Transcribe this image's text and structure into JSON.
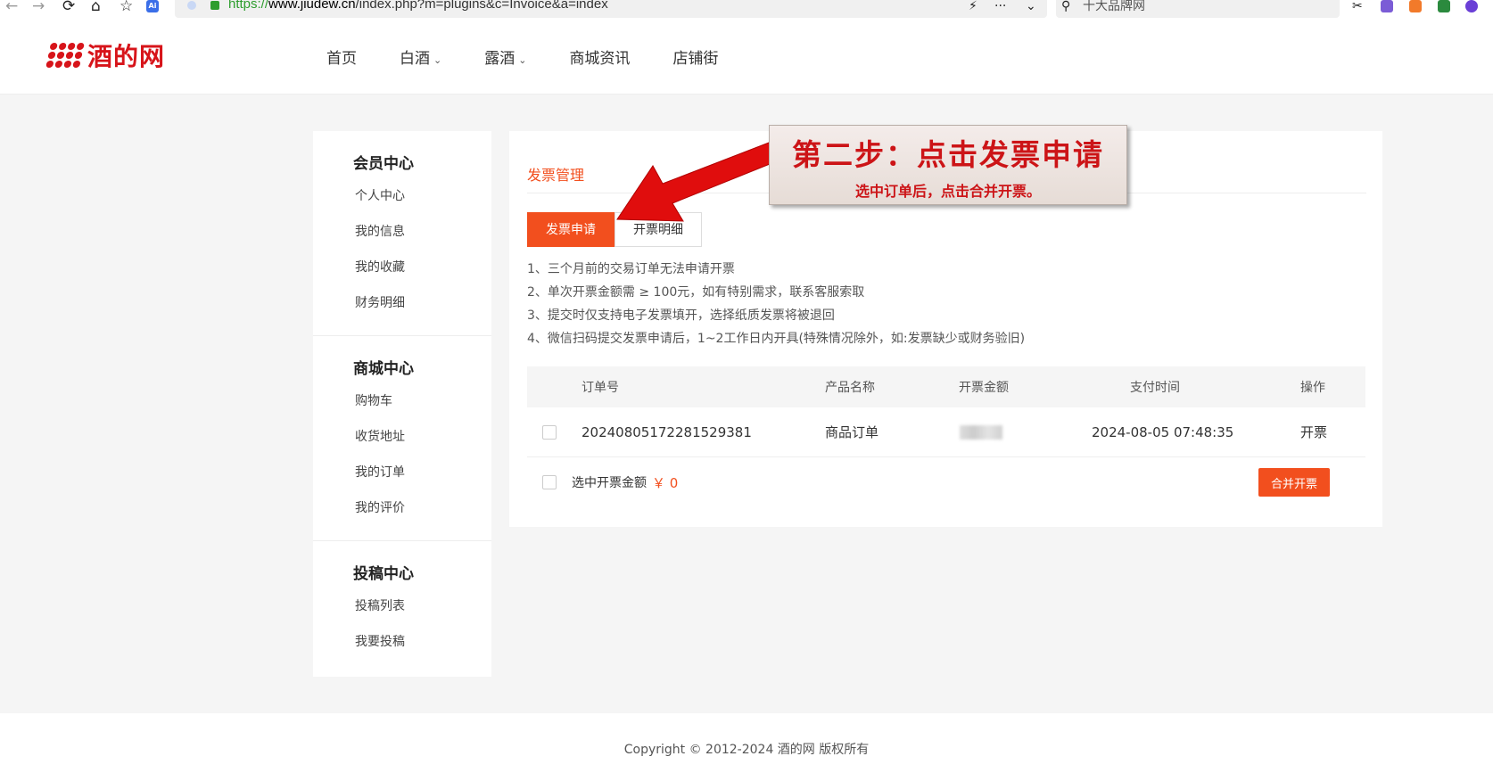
{
  "browser": {
    "url_scheme": "https://",
    "url_host": "www.jiudew.cn",
    "url_path": "/index.php?m=plugins&c=Invoice&a=index",
    "search_text": "十大品牌网",
    "ai_badge": "Ai",
    "more_label": "···"
  },
  "site": {
    "logo_text": "酒的网",
    "brand_color": "#d7141a",
    "accent_color": "#f24f1e"
  },
  "nav": {
    "items": [
      {
        "label": "首页",
        "has_caret": false
      },
      {
        "label": "白酒",
        "has_caret": true
      },
      {
        "label": "露酒",
        "has_caret": true
      },
      {
        "label": "商城资讯",
        "has_caret": false
      },
      {
        "label": "店铺街",
        "has_caret": false
      }
    ],
    "caret": "⌄"
  },
  "sidebar": {
    "sections": [
      {
        "title": "会员中心",
        "links": [
          "个人中心",
          "我的信息",
          "我的收藏",
          "财务明细"
        ]
      },
      {
        "title": "商城中心",
        "links": [
          "购物车",
          "收货地址",
          "我的订单",
          "我的评价"
        ]
      },
      {
        "title": "投稿中心",
        "links": [
          "投稿列表",
          "我要投稿"
        ]
      }
    ]
  },
  "main": {
    "title": "发票管理",
    "tabs": [
      {
        "label": "发票申请",
        "active": true
      },
      {
        "label": "开票明细",
        "active": false
      }
    ],
    "notes": [
      "1、三个月前的交易订单无法申请开票",
      "2、单次开票金额需 ≥ 100元，如有特别需求，联系客服索取",
      "3、提交时仅支持电子发票填开，选择纸质发票将被退回",
      "4、微信扫码提交发票申请后，1~2工作日内开具(特殊情况除外，如:发票缺少或财务验旧)"
    ],
    "table": {
      "headers": [
        "订单号",
        "产品名称",
        "开票金额",
        "支付时间",
        "操作"
      ],
      "rows": [
        {
          "order_no": "20240805172281529381",
          "product": "商品订单",
          "amount": "",
          "pay_time": "2024-08-05 07:48:35",
          "action": "开票"
        }
      ]
    },
    "summary": {
      "label": "选中开票金额",
      "value": "￥ 0"
    },
    "merge_button": "合并开票"
  },
  "annotation": {
    "title": "第二步：点击发票申请",
    "subtitle": "选中订单后，点击合并开票。",
    "color": "#cc1417"
  },
  "footer": {
    "copyright": "Copyright © 2012-2024 酒的网 版权所有"
  }
}
